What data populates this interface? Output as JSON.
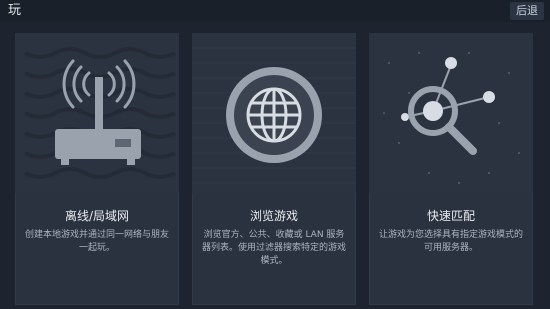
{
  "header": {
    "title": "玩",
    "back_label": "后退"
  },
  "cards": [
    {
      "name": "离线/局域网",
      "desc": "创建本地游戏并通过同一网络与朋友一起玩。",
      "icon": "router-icon"
    },
    {
      "name": "浏览游戏",
      "desc": "浏览官方、公共、收藏或 LAN 服务器列表。使用过滤器搜索特定的游戏模式。",
      "icon": "globe-icon"
    },
    {
      "name": "快速匹配",
      "desc": "让游戏为您选择具有指定游戏模式的可用服务器。",
      "icon": "magnifier-network-icon"
    }
  ]
}
